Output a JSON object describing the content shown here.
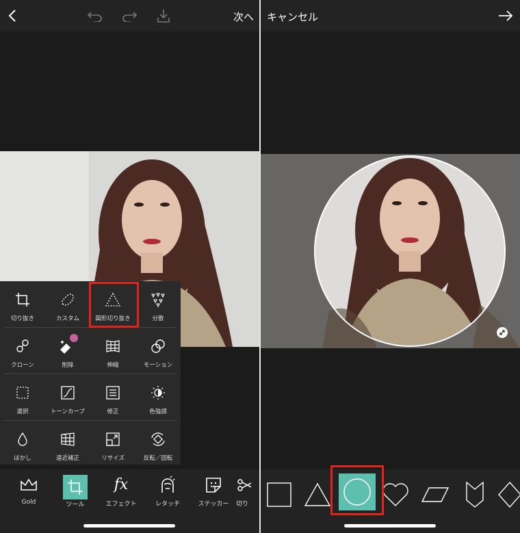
{
  "left": {
    "topbar": {
      "next_label": "次へ"
    },
    "tools": {
      "rows": [
        [
          {
            "label": "切り抜き"
          },
          {
            "label": "カスタム"
          },
          {
            "label": "図形切り抜き"
          },
          {
            "label": "分散"
          }
        ],
        [
          {
            "label": "クローン"
          },
          {
            "label": "削除"
          },
          {
            "label": "伸縮"
          },
          {
            "label": "モーション"
          }
        ],
        [
          {
            "label": "選択"
          },
          {
            "label": "トーンカーブ"
          },
          {
            "label": "修正"
          },
          {
            "label": "色強調"
          }
        ],
        [
          {
            "label": "ぼかし"
          },
          {
            "label": "遠近補正"
          },
          {
            "label": "リサイズ"
          },
          {
            "label": "反転／回転"
          }
        ]
      ]
    },
    "bottombar": {
      "items": [
        {
          "label": "Gold"
        },
        {
          "label": "ツール"
        },
        {
          "label": "エフェクト"
        },
        {
          "label": "レタッチ"
        },
        {
          "label": "ステッカー"
        },
        {
          "label": "切り"
        }
      ]
    }
  },
  "right": {
    "topbar": {
      "cancel_label": "キャンセル"
    },
    "shapes": [
      "square",
      "triangle",
      "circle",
      "heart",
      "parallelogram",
      "chevron",
      "diamond"
    ],
    "selected_shape": "circle"
  },
  "colors": {
    "accent": "#5dbfae",
    "highlight": "#e3241b"
  }
}
